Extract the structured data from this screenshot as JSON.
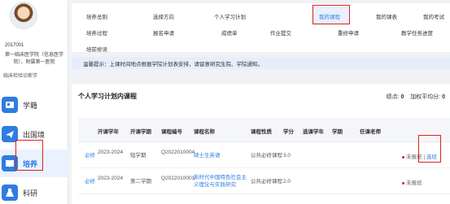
{
  "student": {
    "id": "2017001",
    "affiliation": "第一临床医学院（信息医学院），附属第一医院",
    "tag": "临床检验诊断学"
  },
  "sidebar": {
    "items": [
      {
        "label": "学籍",
        "icon": "id-card-icon"
      },
      {
        "label": "出国境",
        "icon": "plane-icon"
      },
      {
        "label": "培养",
        "icon": "book-icon",
        "active": true
      },
      {
        "label": "科研",
        "icon": "flask-icon"
      }
    ]
  },
  "topmenu": {
    "row1": [
      "培养总则",
      "选择方向",
      "个人学习计划",
      "我的课程",
      "我的课表",
      "我的考试"
    ],
    "row2": [
      "培养过程",
      "报名申请",
      "成绩单",
      "作业提交",
      "重修申请",
      "教学任务进度"
    ],
    "row3": [
      "培前修读"
    ],
    "active": "我的课程"
  },
  "notice": "温馨提示：上课时间地点根据学院计划表安排，请留意研究生院、学院通知。",
  "card": {
    "title": "个人学习计划内课程",
    "credits_label": "绩点:",
    "credits_value": "0",
    "gpa_label": "加权平均分:",
    "gpa_value": "0"
  },
  "table": {
    "headers": [
      "开课学年",
      "开课学期",
      "课程编号",
      "课程名称",
      "课程性质",
      "学分",
      "选课学年",
      "学期",
      "任课老师"
    ],
    "rows": [
      {
        "type": "必修",
        "year": "2023-2024",
        "term": "短学期",
        "code": "Q2022010004",
        "name": "硕士生英语",
        "nature": "公共必修课程",
        "credit": "3.0",
        "status": "未报班",
        "action": "选班"
      },
      {
        "type": "必修",
        "year": "2023-2024",
        "term": "第二学期",
        "code": "Q2022010001",
        "name": "新时代中国特色社会主义理论与实践研究",
        "nature": "公共必修课程",
        "credit": "2.0",
        "status": "未报班",
        "action": ""
      }
    ]
  },
  "colors": {
    "accent": "#2f7de1",
    "highlight": "#e02020"
  }
}
